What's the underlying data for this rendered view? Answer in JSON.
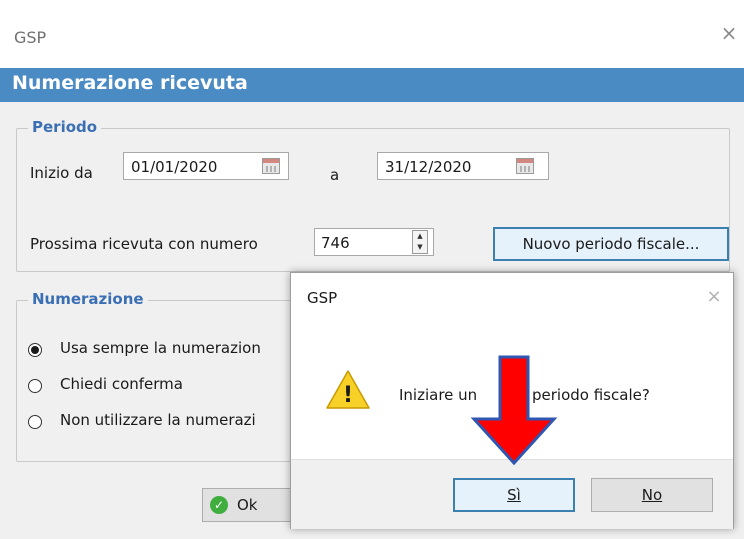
{
  "window": {
    "title": "GSP",
    "close_glyph": "×",
    "banner_title": "Numerazione ricevuta"
  },
  "periodo": {
    "group_title": "Periodo",
    "start_label": "Inizio da",
    "start_date": "01/01/2020",
    "end_label": "a",
    "end_date": "31/12/2020",
    "next_label": "Prossima ricevuta con numero",
    "next_number": "746",
    "new_period_button": "Nuovo periodo fiscale..."
  },
  "numerazione": {
    "group_title": "Numerazione",
    "options": [
      {
        "label": "Usa sempre la numerazion",
        "checked": true
      },
      {
        "label": "Chiedi conferma",
        "checked": false
      },
      {
        "label": "Non utilizzare la numerazi",
        "checked": false
      }
    ]
  },
  "footer": {
    "ok_label": "Ok"
  },
  "message_box": {
    "title": "GSP",
    "close_glyph": "×",
    "icon": "warning-icon",
    "icon_glyph": "!",
    "text_before": "Iniziare un",
    "text_after": "vo periodo fiscale?",
    "yes_label": "Sì",
    "no_label": "No"
  },
  "annotation": {
    "arrow_color": "#ff0000",
    "arrow_outline": "#2f56b0"
  },
  "colors": {
    "banner": "#4a8bc3",
    "group_title": "#3b6fb4",
    "default_button_border": "#3c7fb1",
    "ok_icon": "#3fae3f"
  }
}
